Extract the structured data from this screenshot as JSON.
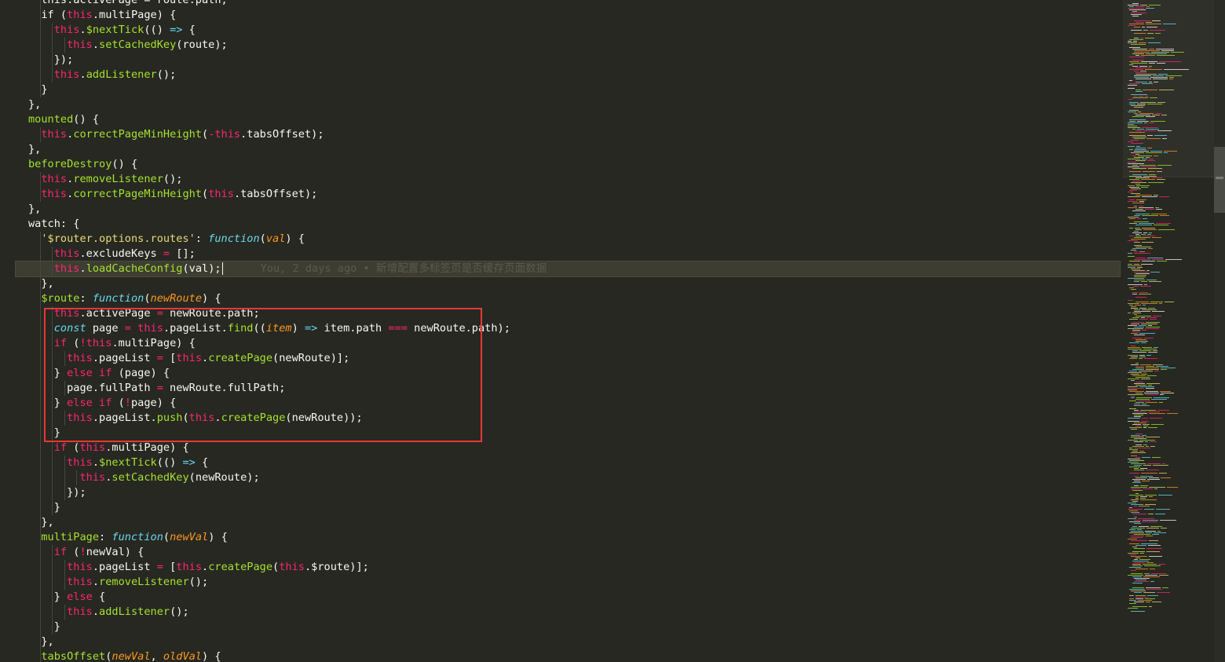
{
  "blame": {
    "text": "You, 2 days ago • 新增配置多标签页是否缓存页面数据"
  },
  "colors": {
    "background": "#272822",
    "keyword": "#f92672",
    "function": "#a6e22e",
    "string": "#e6db74",
    "storage": "#66d9ef",
    "parameter": "#fd971f",
    "highlight_box": "#e53935"
  },
  "code": {
    "lines": [
      [
        [
          "  this.activePage = route.path;",
          "v"
        ]
      ],
      [
        [
          "  if (",
          "v"
        ],
        [
          "this",
          "k"
        ],
        [
          ".multiPage) {",
          "v"
        ]
      ],
      [
        [
          "    ",
          "v"
        ],
        [
          "this",
          "k"
        ],
        [
          ".",
          "v"
        ],
        [
          "$nextTick",
          "f"
        ],
        [
          "(() ",
          "v"
        ],
        [
          "=>",
          "t"
        ],
        [
          " {",
          "v"
        ]
      ],
      [
        [
          "      ",
          "v"
        ],
        [
          "this",
          "k"
        ],
        [
          ".",
          "v"
        ],
        [
          "setCachedKey",
          "f"
        ],
        [
          "(route);",
          "v"
        ]
      ],
      [
        [
          "    });",
          "v"
        ]
      ],
      [
        [
          "    ",
          "v"
        ],
        [
          "this",
          "k"
        ],
        [
          ".",
          "v"
        ],
        [
          "addListener",
          "f"
        ],
        [
          "();",
          "v"
        ]
      ],
      [
        [
          "  }",
          "v"
        ]
      ],
      [
        [
          "},",
          "v"
        ]
      ],
      [
        [
          "mounted",
          "f"
        ],
        [
          "() {",
          "v"
        ]
      ],
      [
        [
          "  ",
          "v"
        ],
        [
          "this",
          "k"
        ],
        [
          ".",
          "v"
        ],
        [
          "correctPageMinHeight",
          "f"
        ],
        [
          "(",
          "v"
        ],
        [
          "-",
          "k"
        ],
        [
          "this",
          "k"
        ],
        [
          ".tabsOffset);",
          "v"
        ]
      ],
      [
        [
          "},",
          "v"
        ]
      ],
      [
        [
          "beforeDestroy",
          "f"
        ],
        [
          "() {",
          "v"
        ]
      ],
      [
        [
          "  ",
          "v"
        ],
        [
          "this",
          "k"
        ],
        [
          ".",
          "v"
        ],
        [
          "removeListener",
          "f"
        ],
        [
          "();",
          "v"
        ]
      ],
      [
        [
          "  ",
          "v"
        ],
        [
          "this",
          "k"
        ],
        [
          ".",
          "v"
        ],
        [
          "correctPageMinHeight",
          "f"
        ],
        [
          "(",
          "v"
        ],
        [
          "this",
          "k"
        ],
        [
          ".tabsOffset);",
          "v"
        ]
      ],
      [
        [
          "},",
          "v"
        ]
      ],
      [
        [
          "watch: {",
          "v"
        ]
      ],
      [
        [
          "  ",
          "v"
        ],
        [
          "'$router.options.routes'",
          "s"
        ],
        [
          ": ",
          "v"
        ],
        [
          "function",
          "t"
        ],
        [
          "(",
          "v"
        ],
        [
          "val",
          "p"
        ],
        [
          ") {",
          "v"
        ]
      ],
      [
        [
          "    ",
          "v"
        ],
        [
          "this",
          "k"
        ],
        [
          ".excludeKeys ",
          "v"
        ],
        [
          "=",
          "k"
        ],
        [
          " [];",
          "v"
        ]
      ],
      [
        [
          "    ",
          "v"
        ],
        [
          "this",
          "k"
        ],
        [
          ".",
          "v"
        ],
        [
          "loadCacheConfig",
          "f"
        ],
        [
          "(val);",
          "v"
        ]
      ],
      [
        [
          "  },",
          "v"
        ]
      ],
      [
        [
          "  ",
          "v"
        ],
        [
          "$route",
          "f"
        ],
        [
          ": ",
          "v"
        ],
        [
          "function",
          "t"
        ],
        [
          "(",
          "v"
        ],
        [
          "newRoute",
          "p"
        ],
        [
          ") {",
          "v"
        ]
      ],
      [
        [
          "    ",
          "v"
        ],
        [
          "this",
          "k"
        ],
        [
          ".activePage ",
          "v"
        ],
        [
          "=",
          "k"
        ],
        [
          " newRoute.path;",
          "v"
        ]
      ],
      [
        [
          "    ",
          "v"
        ],
        [
          "const",
          "t"
        ],
        [
          " page ",
          "v"
        ],
        [
          "=",
          "k"
        ],
        [
          " ",
          "v"
        ],
        [
          "this",
          "k"
        ],
        [
          ".pageList.",
          "v"
        ],
        [
          "find",
          "f"
        ],
        [
          "((",
          "v"
        ],
        [
          "item",
          "p"
        ],
        [
          ") ",
          "v"
        ],
        [
          "=>",
          "t"
        ],
        [
          " item.path ",
          "v"
        ],
        [
          "===",
          "k"
        ],
        [
          " newRoute.path);",
          "v"
        ]
      ],
      [
        [
          "    ",
          "v"
        ],
        [
          "if",
          "k"
        ],
        [
          " (",
          "v"
        ],
        [
          "!",
          "k"
        ],
        [
          "this",
          "k"
        ],
        [
          ".multiPage) {",
          "v"
        ]
      ],
      [
        [
          "      ",
          "v"
        ],
        [
          "this",
          "k"
        ],
        [
          ".pageList ",
          "v"
        ],
        [
          "=",
          "k"
        ],
        [
          " [",
          "v"
        ],
        [
          "this",
          "k"
        ],
        [
          ".",
          "v"
        ],
        [
          "createPage",
          "f"
        ],
        [
          "(newRoute)];",
          "v"
        ]
      ],
      [
        [
          "    } ",
          "v"
        ],
        [
          "else",
          "k"
        ],
        [
          " ",
          "v"
        ],
        [
          "if",
          "k"
        ],
        [
          " (page) {",
          "v"
        ]
      ],
      [
        [
          "      page.fullPath ",
          "v"
        ],
        [
          "=",
          "k"
        ],
        [
          " newRoute.fullPath;",
          "v"
        ]
      ],
      [
        [
          "    } ",
          "v"
        ],
        [
          "else",
          "k"
        ],
        [
          " ",
          "v"
        ],
        [
          "if",
          "k"
        ],
        [
          " (",
          "v"
        ],
        [
          "!",
          "k"
        ],
        [
          "page) {",
          "v"
        ]
      ],
      [
        [
          "      ",
          "v"
        ],
        [
          "this",
          "k"
        ],
        [
          ".pageList.",
          "v"
        ],
        [
          "push",
          "f"
        ],
        [
          "(",
          "v"
        ],
        [
          "this",
          "k"
        ],
        [
          ".",
          "v"
        ],
        [
          "createPage",
          "f"
        ],
        [
          "(newRoute));",
          "v"
        ]
      ],
      [
        [
          "    }",
          "v"
        ]
      ],
      [
        [
          "    ",
          "v"
        ],
        [
          "if",
          "k"
        ],
        [
          " (",
          "v"
        ],
        [
          "this",
          "k"
        ],
        [
          ".multiPage) {",
          "v"
        ]
      ],
      [
        [
          "      ",
          "v"
        ],
        [
          "this",
          "k"
        ],
        [
          ".",
          "v"
        ],
        [
          "$nextTick",
          "f"
        ],
        [
          "(() ",
          "v"
        ],
        [
          "=>",
          "t"
        ],
        [
          " {",
          "v"
        ]
      ],
      [
        [
          "        ",
          "v"
        ],
        [
          "this",
          "k"
        ],
        [
          ".",
          "v"
        ],
        [
          "setCachedKey",
          "f"
        ],
        [
          "(newRoute);",
          "v"
        ]
      ],
      [
        [
          "      });",
          "v"
        ]
      ],
      [
        [
          "    }",
          "v"
        ]
      ],
      [
        [
          "  },",
          "v"
        ]
      ],
      [
        [
          "  ",
          "v"
        ],
        [
          "multiPage",
          "f"
        ],
        [
          ": ",
          "v"
        ],
        [
          "function",
          "t"
        ],
        [
          "(",
          "v"
        ],
        [
          "newVal",
          "p"
        ],
        [
          ") {",
          "v"
        ]
      ],
      [
        [
          "    ",
          "v"
        ],
        [
          "if",
          "k"
        ],
        [
          " (",
          "v"
        ],
        [
          "!",
          "k"
        ],
        [
          "newVal) {",
          "v"
        ]
      ],
      [
        [
          "      ",
          "v"
        ],
        [
          "this",
          "k"
        ],
        [
          ".pageList ",
          "v"
        ],
        [
          "=",
          "k"
        ],
        [
          " [",
          "v"
        ],
        [
          "this",
          "k"
        ],
        [
          ".",
          "v"
        ],
        [
          "createPage",
          "f"
        ],
        [
          "(",
          "v"
        ],
        [
          "this",
          "k"
        ],
        [
          ".$route)];",
          "v"
        ]
      ],
      [
        [
          "      ",
          "v"
        ],
        [
          "this",
          "k"
        ],
        [
          ".",
          "v"
        ],
        [
          "removeListener",
          "f"
        ],
        [
          "();",
          "v"
        ]
      ],
      [
        [
          "    } ",
          "v"
        ],
        [
          "else",
          "k"
        ],
        [
          " {",
          "v"
        ]
      ],
      [
        [
          "      ",
          "v"
        ],
        [
          "this",
          "k"
        ],
        [
          ".",
          "v"
        ],
        [
          "addListener",
          "f"
        ],
        [
          "();",
          "v"
        ]
      ],
      [
        [
          "    }",
          "v"
        ]
      ],
      [
        [
          "  },",
          "v"
        ]
      ],
      [
        [
          "  ",
          "v"
        ],
        [
          "tabsOffset",
          "f"
        ],
        [
          "(",
          "v"
        ],
        [
          "newVal",
          "p"
        ],
        [
          ", ",
          "v"
        ],
        [
          "oldVal",
          "p"
        ],
        [
          ") {",
          "v"
        ]
      ]
    ],
    "current_line_index": 18
  }
}
